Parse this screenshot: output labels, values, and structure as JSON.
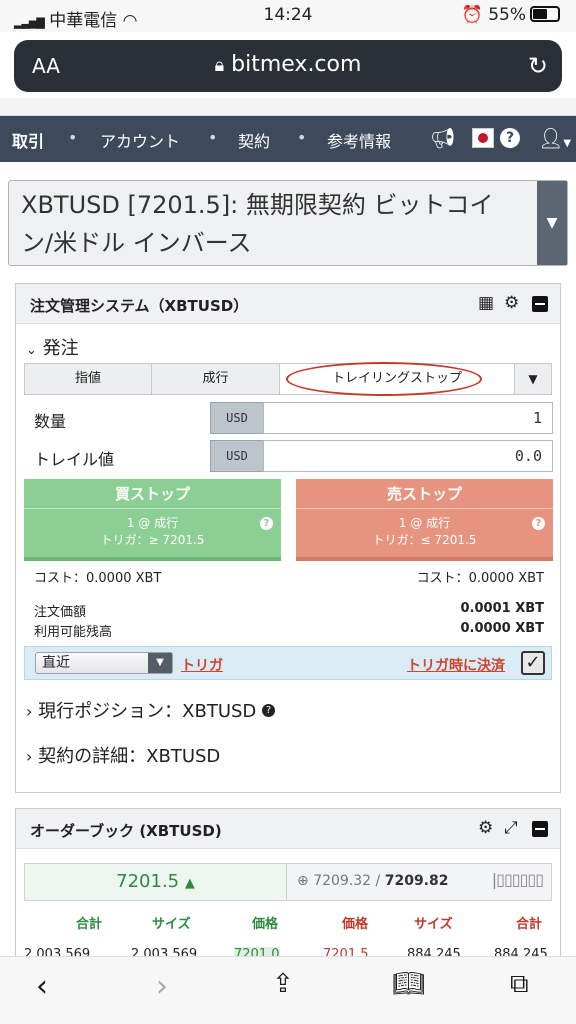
{
  "status_bar": {
    "carrier": "中華電信",
    "time": "14:24",
    "battery": "55%"
  },
  "browser": {
    "aa": "AA",
    "url": "bitmex.com"
  },
  "nav": {
    "items": [
      "取引",
      "アカウント",
      "契約",
      "参考情報"
    ]
  },
  "symbol": {
    "label": "XBTUSD [7201.5]: 無期限契約 ビットコイン/米ドル インバース"
  },
  "order_panel": {
    "title": "注文管理システム（XBTUSD）",
    "section": "発注",
    "tabs": [
      "指値",
      "成行",
      "トレイリングストップ"
    ],
    "quantity": {
      "label": "数量",
      "unit": "USD",
      "value": "1"
    },
    "trail": {
      "label": "トレイル値",
      "unit": "USD",
      "value": "0.0"
    },
    "buy": {
      "title": "買ストップ",
      "line1": "1 @ 成行",
      "line2": "トリガ：≥ 7201.5",
      "cost": "コスト：0.0000 XBT"
    },
    "sell": {
      "title": "売ストップ",
      "line1": "1 @ 成行",
      "line2": "トリガ：≤ 7201.5",
      "cost": "コスト：0.0000 XBT"
    },
    "order_value": {
      "label": "注文価額",
      "value": "0.0001 XBT"
    },
    "available": {
      "label": "利用可能残高",
      "value": "0.0000 XBT"
    },
    "trigger_select": "直近",
    "trigger_label": "トリガ",
    "close_on_trigger": "トリガ時に決済",
    "position": "現行ポジション：XBTUSD",
    "contract": "契約の詳細：XBTUSD"
  },
  "orderbook": {
    "title": "オーダーブック (XBTUSD)",
    "last_price": "7201.5",
    "index_price": "7209.32",
    "mark_price": "7209.82",
    "headers": [
      "合計",
      "サイズ",
      "価格",
      "価格",
      "サイズ",
      "合計"
    ],
    "row": [
      "2,003,569",
      "2,003,569",
      "7201.0",
      "7201.5",
      "884,245",
      "884,245"
    ]
  },
  "colors": {
    "nav": "#3d4a5b",
    "buy": "#8ccf95",
    "sell": "#e69480",
    "trigger_bar": "#d9ecf5"
  }
}
